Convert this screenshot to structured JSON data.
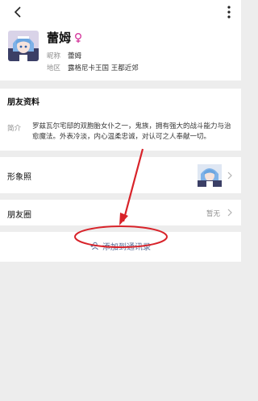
{
  "profile": {
    "name": "蕾姆",
    "nickname_label": "昵称",
    "nickname": "蕾姆",
    "region_label": "地区",
    "region": "露格尼卡王国 王都近郊"
  },
  "friend_info": {
    "title": "朋友资料",
    "intro_label": "简介",
    "intro_text": "罗兹瓦尔宅邸的双胞胎女仆之一，鬼族，拥有强大的战斗能力与治愈魔法。外表冷淡，内心温柔忠诚，对认可之人奉献一切。"
  },
  "photos": {
    "label": "形象照"
  },
  "moments": {
    "label": "朋友圈",
    "value": "暂无"
  },
  "actions": {
    "add_contact": "添加到通讯录"
  },
  "colors": {
    "accent_link": "#576b95",
    "gender_female": "#d63a9e",
    "annotation_red": "#d8232a",
    "background": "#ededed"
  },
  "icons": {
    "back": "back-arrow-icon",
    "more": "more-vertical-icon",
    "gender": "female-icon",
    "chevron": "chevron-right-icon",
    "add_contact": "add-user-icon"
  }
}
